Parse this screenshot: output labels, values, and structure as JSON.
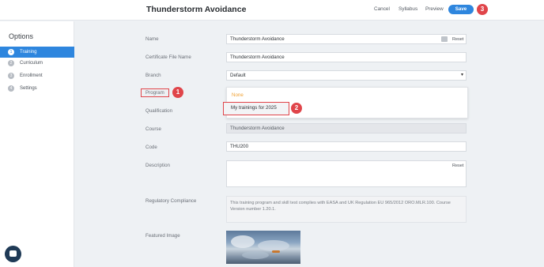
{
  "header": {
    "title": "Thunderstorm Avoidance",
    "cancel_label": "Cancel",
    "syllabus_label": "Syllabus",
    "preview_label": "Preview",
    "save_label": "Save"
  },
  "sidebar": {
    "title": "Options",
    "items": [
      {
        "num": "1",
        "label": "Training"
      },
      {
        "num": "2",
        "label": "Curriculum"
      },
      {
        "num": "3",
        "label": "Enrollment"
      },
      {
        "num": "4",
        "label": "Settings"
      }
    ]
  },
  "form": {
    "name_label": "Name",
    "name_value": "Thunderstorm Avoidance",
    "name_reset": "Reset",
    "certificate_label": "Certificate File Name",
    "certificate_value": "Thunderstorm Avoidance",
    "branch_label": "Branch",
    "branch_value": "Default",
    "program_label": "Program",
    "program_options": [
      "None",
      "My trainings for 2025"
    ],
    "qualification_label": "Qualification",
    "course_label": "Course",
    "course_value": "Thunderstorm Avoidance",
    "code_label": "Code",
    "code_value": "THU200",
    "description_label": "Description",
    "description_reset": "Reset",
    "compliance_label": "Regulatory Compliance",
    "compliance_text": "This training program and skill test complies with EASA and UK Regulation EU 965/2012 ORO.MLR.100. Course Version number 1.20.1.",
    "image_label": "Featured Image"
  },
  "annotations": [
    "1",
    "2",
    "3"
  ],
  "colors": {
    "accent": "#2e86de",
    "annotation": "#e0454a",
    "none_option": "#f0a030"
  }
}
